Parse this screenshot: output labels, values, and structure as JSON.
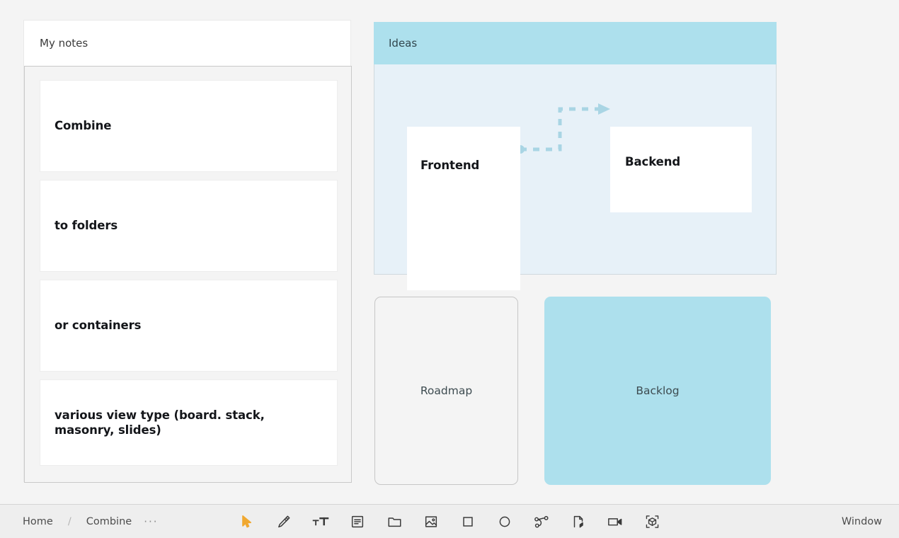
{
  "notes_panel": {
    "title": "My notes",
    "cards": [
      {
        "text": "Combine"
      },
      {
        "text": "to folders"
      },
      {
        "text": "or containers"
      },
      {
        "text": "various view type (board. stack, masonry, slides)"
      }
    ]
  },
  "ideas_panel": {
    "title": "Ideas",
    "header_color": "#ade0ed",
    "body_color": "#e7f1f8",
    "connector_color": "#a9d5e4",
    "nodes": [
      {
        "label": "Frontend"
      },
      {
        "label": "Backend"
      }
    ]
  },
  "board_cards": [
    {
      "label": "Roadmap",
      "color": "#f4f4f4"
    },
    {
      "label": "Backlog",
      "color": "#ade0ed"
    }
  ],
  "toolbar": {
    "breadcrumb": {
      "home": "Home",
      "separator": "/",
      "current": "Combine",
      "more": "···"
    },
    "active_tool_color": "#f0a830",
    "tools": [
      {
        "name": "cursor-icon",
        "label": "Select",
        "active": true
      },
      {
        "name": "pencil-icon",
        "label": "Draw",
        "active": false
      },
      {
        "name": "text-size-icon",
        "label": "Text",
        "active": false
      },
      {
        "name": "note-icon",
        "label": "Note",
        "active": false
      },
      {
        "name": "folder-icon",
        "label": "Folder",
        "active": false
      },
      {
        "name": "image-icon",
        "label": "Image",
        "active": false
      },
      {
        "name": "square-icon",
        "label": "Rectangle",
        "active": false
      },
      {
        "name": "circle-icon",
        "label": "Ellipse",
        "active": false
      },
      {
        "name": "connector-icon",
        "label": "Connector",
        "active": false
      },
      {
        "name": "audio-file-icon",
        "label": "Audio",
        "active": false
      },
      {
        "name": "video-camera-icon",
        "label": "Video",
        "active": false
      },
      {
        "name": "cube-3d-icon",
        "label": "3D object",
        "active": false
      }
    ],
    "window_label": "Window"
  }
}
